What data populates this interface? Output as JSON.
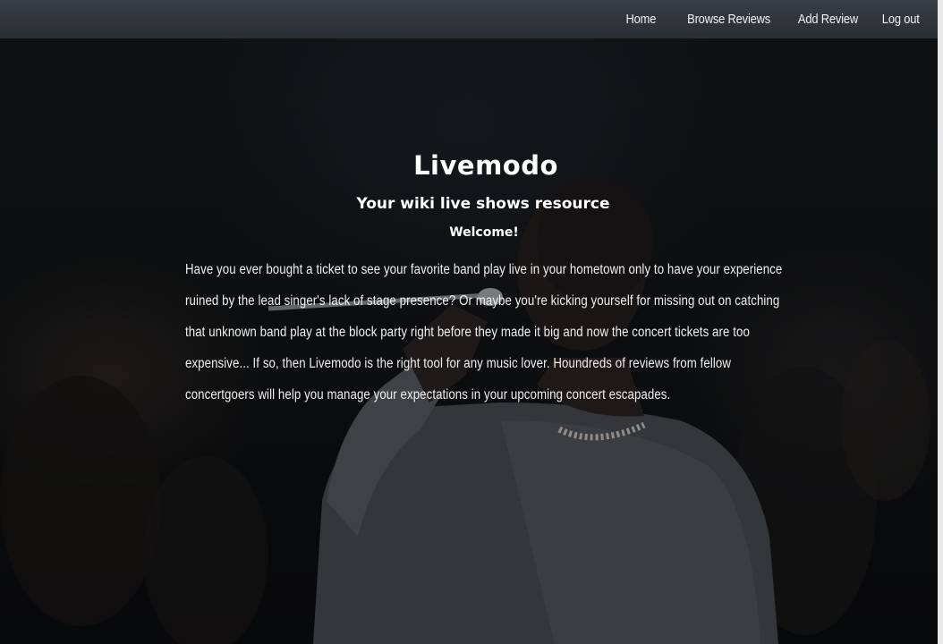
{
  "nav": {
    "links": [
      "Home",
      "Browse Reviews",
      "Add Review",
      "Log out"
    ]
  },
  "hero": {
    "title": "Livemodo",
    "tagline": "Your wiki live shows resource",
    "welcome": "Welcome!",
    "intro": "Have you ever bought a ticket to see your favorite band play live in your hometown only to have your experience ruined by the lead singer's lack of stage presence? Or maybe you're kicking yourself for missing out on catching that unknown band play at the block party right before they made it big and now the concert tickets are too expensive... If so, then Livemodo is the right tool for any music lover. Houndreds of reviews from fellow concertgoers will help you manage your expectations in your upcoming concert escapades."
  },
  "background_image": "concert-singer-photo"
}
